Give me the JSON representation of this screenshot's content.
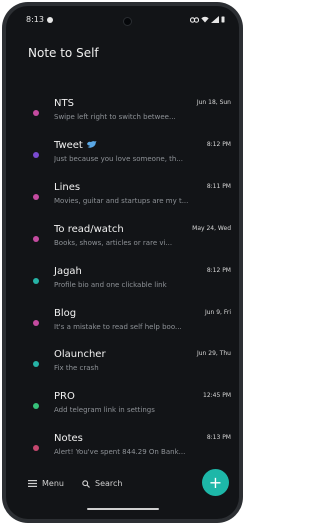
{
  "status_bar": {
    "time": "8:13"
  },
  "app": {
    "title": "Note to Self"
  },
  "notes": [
    {
      "title": "NTS",
      "date": "Jun 18, Sun",
      "preview": "Swipe left right to switch betwee...",
      "color": "#c44ba0"
    },
    {
      "title": "Tweet",
      "date": "8:12 PM",
      "preview": "Just because you love someone, th...",
      "color": "#7a4bd0",
      "icon": "bird-icon"
    },
    {
      "title": "Lines",
      "date": "8:11 PM",
      "preview": "Movies, guitar and startups are my t...",
      "color": "#c44ba0"
    },
    {
      "title": "To read/watch",
      "date": "May 24, Wed",
      "preview": "Books, shows, articles or rare vi...",
      "color": "#c44ba0"
    },
    {
      "title": "Jagah",
      "date": "8:12 PM",
      "preview": "Profile bio and one clickable link",
      "color": "#26b3a6"
    },
    {
      "title": "Blog",
      "date": "Jun 9, Fri",
      "preview": "It's a mistake to read self help boo...",
      "color": "#c44ba0"
    },
    {
      "title": "Olauncher",
      "date": "Jun 29, Thu",
      "preview": "Fix the crash",
      "color": "#26b3a6"
    },
    {
      "title": "PRO",
      "date": "12:45 PM",
      "preview": "Add telegram link in settings",
      "color": "#36c27a"
    },
    {
      "title": "Notes",
      "date": "8:13 PM",
      "preview": "Alert! You've spent 844.29 On Bank...",
      "color": "#c4476e"
    }
  ],
  "bottom_bar": {
    "menu_label": "Menu",
    "search_label": "Search",
    "fab_label": "+",
    "accent_color": "#1db7a8"
  }
}
